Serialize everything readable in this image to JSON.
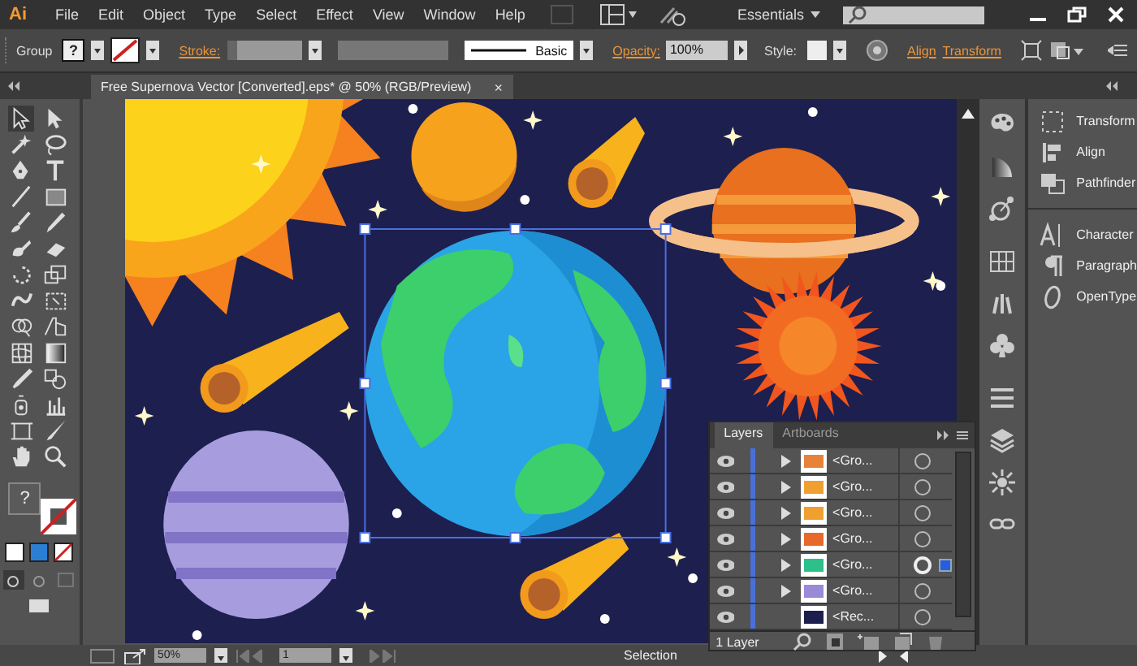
{
  "app": {
    "logo": "Ai",
    "menu": [
      "File",
      "Edit",
      "Object",
      "Type",
      "Select",
      "Effect",
      "View",
      "Window",
      "Help"
    ],
    "workspace": "Essentials"
  },
  "control_bar": {
    "selection": "Group",
    "fill_label": "?",
    "stroke_label": "Stroke:",
    "profile": "Basic",
    "opacity_label": "Opacity:",
    "opacity": "100%",
    "style_label": "Style:",
    "align": "Align",
    "transform": "Transform"
  },
  "document_tab": {
    "title": "Free Supernova Vector [Converted].eps* @ 50% (RGB/Preview)",
    "close": "×"
  },
  "toolbar": {
    "fill_label": "?"
  },
  "panels": [
    {
      "label": "Transform"
    },
    {
      "label": "Align"
    },
    {
      "label": "Pathfinder"
    },
    {
      "label": "Character"
    },
    {
      "label": "Paragraph"
    },
    {
      "label": "OpenType"
    }
  ],
  "layers_panel": {
    "tabs": [
      {
        "label": "Layers",
        "selected": true
      },
      {
        "label": "Artboards",
        "selected": false
      }
    ],
    "rows": [
      {
        "name": "<Gro...",
        "expandable": true,
        "targeted": false,
        "color": "#e8823a"
      },
      {
        "name": "<Gro...",
        "expandable": true,
        "targeted": false,
        "color": "#f0a030"
      },
      {
        "name": "<Gro...",
        "expandable": true,
        "targeted": false,
        "color": "#f0a030"
      },
      {
        "name": "<Gro...",
        "expandable": true,
        "targeted": false,
        "color": "#e86a2a"
      },
      {
        "name": "<Gro...",
        "expandable": true,
        "targeted": true,
        "color": "#2ec08a"
      },
      {
        "name": "<Gro...",
        "expandable": true,
        "targeted": false,
        "color": "#9a8ad8"
      },
      {
        "name": "<Rec...",
        "expandable": false,
        "targeted": false,
        "color": "#1c1f4e"
      }
    ],
    "footer": "1 Layer"
  },
  "status_bar": {
    "zoom": "50%",
    "artboard": "1",
    "tool": "Selection"
  }
}
